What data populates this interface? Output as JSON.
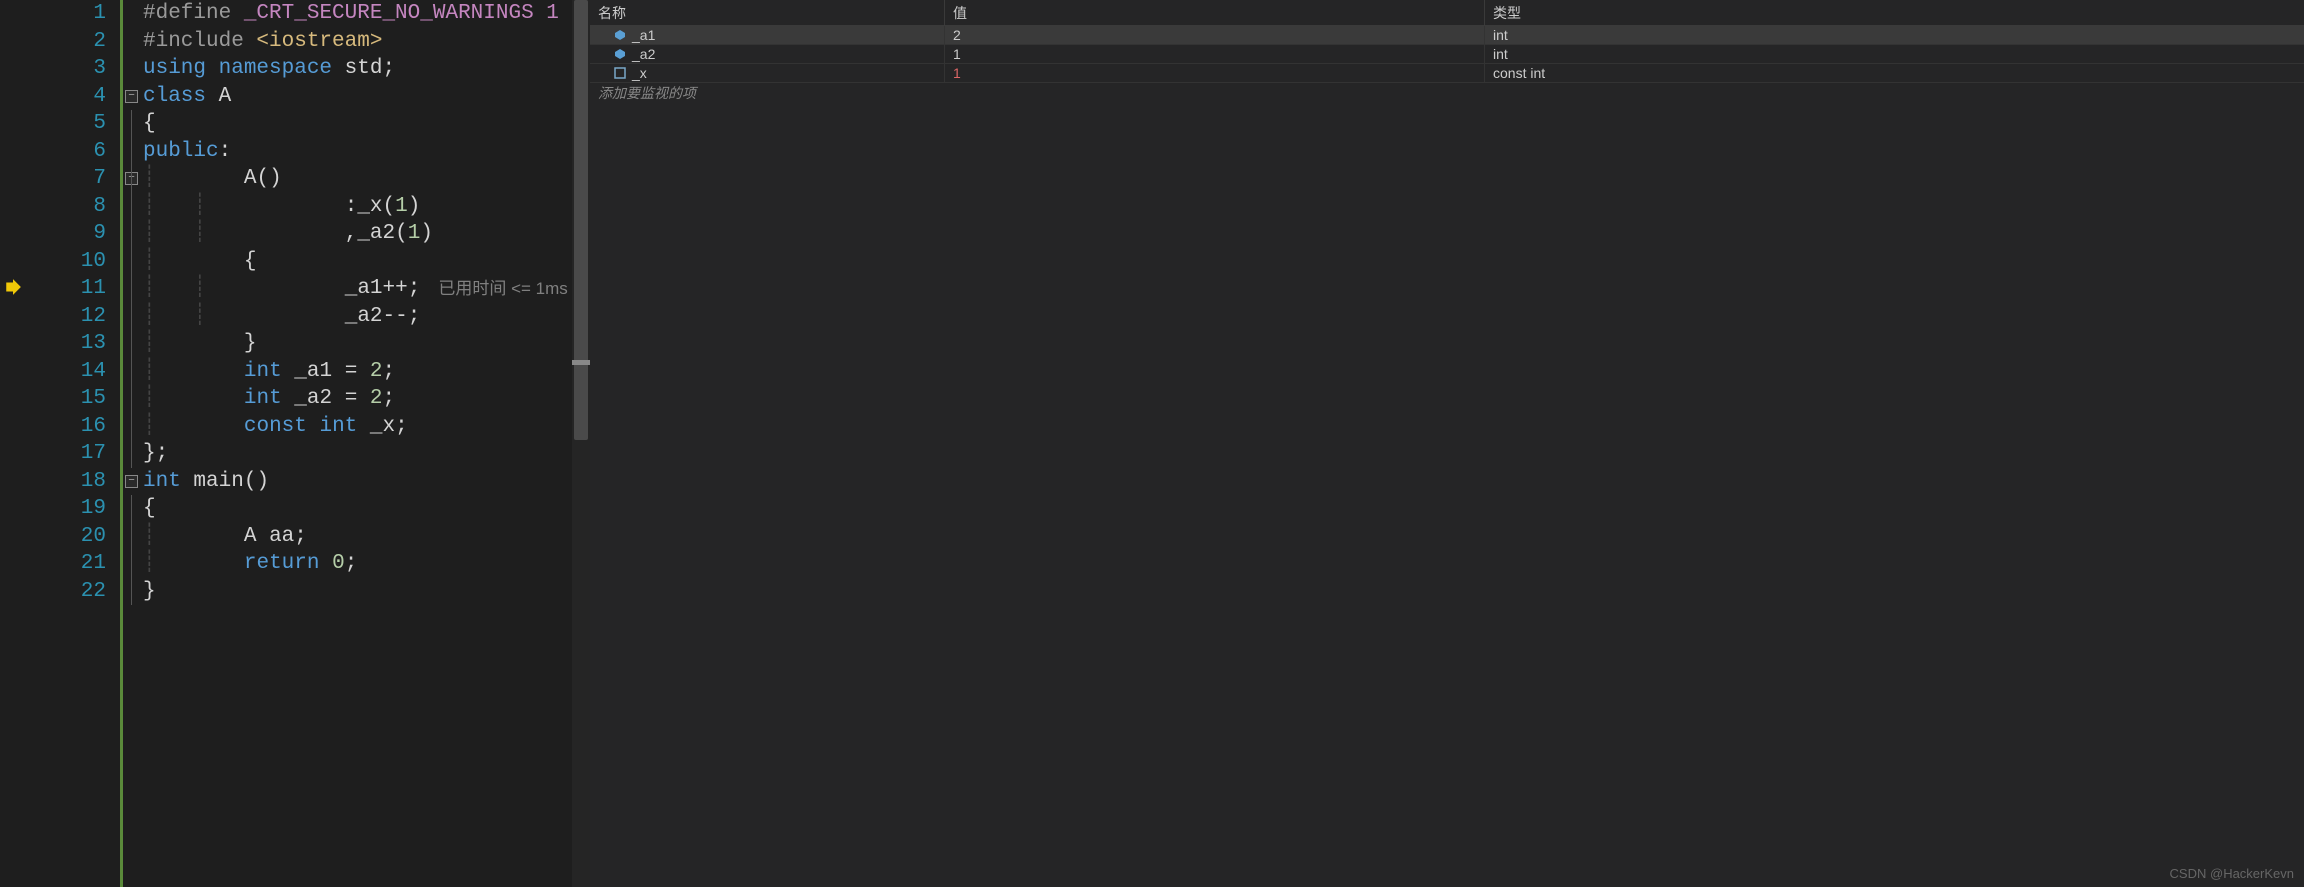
{
  "editor": {
    "current_line": 11,
    "lines": [
      {
        "n": 1,
        "tokens": [
          {
            "t": "#define ",
            "c": "kw-pre"
          },
          {
            "t": "_CRT_SECURE_NO_WARNINGS 1",
            "c": "macro"
          }
        ]
      },
      {
        "n": 2,
        "tokens": [
          {
            "t": "#include ",
            "c": "kw-pre"
          },
          {
            "t": "<iostream>",
            "c": "str"
          }
        ]
      },
      {
        "n": 3,
        "tokens": [
          {
            "t": "using namespace ",
            "c": "kw"
          },
          {
            "t": "std",
            "c": "ident"
          },
          {
            "t": ";",
            "c": "op"
          }
        ]
      },
      {
        "n": 4,
        "fold": true,
        "tokens": [
          {
            "t": "class ",
            "c": "kw"
          },
          {
            "t": "A",
            "c": "ident"
          }
        ]
      },
      {
        "n": 5,
        "tokens": [
          {
            "t": "{",
            "c": "bracket"
          }
        ]
      },
      {
        "n": 6,
        "tokens": [
          {
            "t": "public",
            "c": "kw"
          },
          {
            "t": ":",
            "c": "op"
          }
        ]
      },
      {
        "n": 7,
        "fold": true,
        "indent": 1,
        "tokens": [
          {
            "t": "    A",
            "c": "ident"
          },
          {
            "t": "()",
            "c": "bracket"
          }
        ]
      },
      {
        "n": 8,
        "indent": 2,
        "tokens": [
          {
            "t": "        :_x",
            "c": "ident"
          },
          {
            "t": "(",
            "c": "bracket"
          },
          {
            "t": "1",
            "c": "num"
          },
          {
            "t": ")",
            "c": "bracket"
          }
        ]
      },
      {
        "n": 9,
        "indent": 2,
        "tokens": [
          {
            "t": "        ,_a2",
            "c": "ident"
          },
          {
            "t": "(",
            "c": "bracket"
          },
          {
            "t": "1",
            "c": "num"
          },
          {
            "t": ")",
            "c": "bracket"
          }
        ]
      },
      {
        "n": 10,
        "indent": 1,
        "tokens": [
          {
            "t": "    {",
            "c": "bracket"
          }
        ]
      },
      {
        "n": 11,
        "indent": 2,
        "hint": true,
        "tokens": [
          {
            "t": "        _a1",
            "c": "ident"
          },
          {
            "t": "++;",
            "c": "op"
          }
        ]
      },
      {
        "n": 12,
        "indent": 2,
        "tokens": [
          {
            "t": "        _a2",
            "c": "ident"
          },
          {
            "t": "--;",
            "c": "op"
          }
        ]
      },
      {
        "n": 13,
        "indent": 1,
        "tokens": [
          {
            "t": "    }",
            "c": "bracket"
          }
        ]
      },
      {
        "n": 14,
        "indent": 1,
        "tokens": [
          {
            "t": "    int ",
            "c": "type"
          },
          {
            "t": "_a1 ",
            "c": "ident"
          },
          {
            "t": "= ",
            "c": "op"
          },
          {
            "t": "2",
            "c": "num"
          },
          {
            "t": ";",
            "c": "op"
          }
        ]
      },
      {
        "n": 15,
        "indent": 1,
        "tokens": [
          {
            "t": "    int ",
            "c": "type"
          },
          {
            "t": "_a2 ",
            "c": "ident"
          },
          {
            "t": "= ",
            "c": "op"
          },
          {
            "t": "2",
            "c": "num"
          },
          {
            "t": ";",
            "c": "op"
          }
        ]
      },
      {
        "n": 16,
        "indent": 1,
        "tokens": [
          {
            "t": "    const int ",
            "c": "type"
          },
          {
            "t": "_x",
            "c": "ident"
          },
          {
            "t": ";",
            "c": "op"
          }
        ]
      },
      {
        "n": 17,
        "tokens": [
          {
            "t": "}",
            "c": "bracket"
          },
          {
            "t": ";",
            "c": "op"
          }
        ]
      },
      {
        "n": 18,
        "fold": true,
        "tokens": [
          {
            "t": "int ",
            "c": "type"
          },
          {
            "t": "main",
            "c": "ident"
          },
          {
            "t": "()",
            "c": "bracket"
          }
        ]
      },
      {
        "n": 19,
        "tokens": [
          {
            "t": "{",
            "c": "bracket"
          }
        ]
      },
      {
        "n": 20,
        "indent": 1,
        "tokens": [
          {
            "t": "    A aa",
            "c": "ident"
          },
          {
            "t": ";",
            "c": "op"
          }
        ]
      },
      {
        "n": 21,
        "indent": 1,
        "tokens": [
          {
            "t": "    return ",
            "c": "kw"
          },
          {
            "t": "0",
            "c": "num"
          },
          {
            "t": ";",
            "c": "op"
          }
        ]
      },
      {
        "n": 22,
        "tokens": [
          {
            "t": "}",
            "c": "bracket"
          }
        ]
      }
    ],
    "inline_hint": "已用时间 <= 1ms"
  },
  "watch": {
    "headers": {
      "name": "名称",
      "value": "值",
      "type": "类型"
    },
    "rows": [
      {
        "icon": "field",
        "name": "_a1",
        "value": "2",
        "type": "int",
        "selected": true,
        "changed": false
      },
      {
        "icon": "field",
        "name": "_a2",
        "value": "1",
        "type": "int",
        "selected": false,
        "changed": false
      },
      {
        "icon": "const",
        "name": "_x",
        "value": "1",
        "type": "const int",
        "selected": false,
        "changed": true
      }
    ],
    "placeholder": "添加要监视的项"
  },
  "watermark": "CSDN @HackerKevn"
}
